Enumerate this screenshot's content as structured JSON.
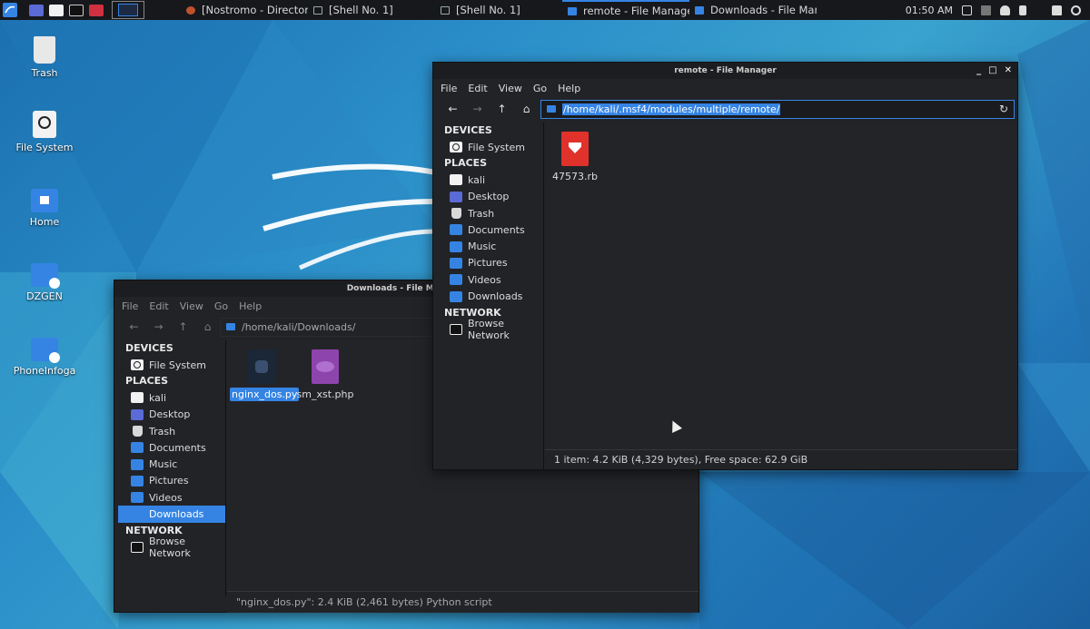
{
  "panel": {
    "tasks": [
      {
        "label": "[Nostromo - Directory T..."
      },
      {
        "label": "[Shell No. 1]"
      },
      {
        "label": "[Shell No. 1]"
      },
      {
        "label": "remote - File Manager"
      },
      {
        "label": "Downloads - File Manag..."
      }
    ],
    "clock": "01:50 AM"
  },
  "desktop": {
    "icons": [
      {
        "label": "Trash"
      },
      {
        "label": "File System"
      },
      {
        "label": "Home"
      },
      {
        "label": "DZGEN"
      },
      {
        "label": "PhoneInfoga"
      }
    ]
  },
  "menu": [
    "File",
    "Edit",
    "View",
    "Go",
    "Help"
  ],
  "sidebar": {
    "devices_header": "DEVICES",
    "places_header": "PLACES",
    "network_header": "NETWORK",
    "file_system": "File System",
    "places": [
      "kali",
      "Desktop",
      "Trash",
      "Documents",
      "Music",
      "Pictures",
      "Videos",
      "Downloads"
    ],
    "browse_network": "Browse Network"
  },
  "win_remote": {
    "title": "remote - File Manager",
    "path": "/home/kali/.msf4/modules/multiple/remote/",
    "files": [
      {
        "name": "47573.rb",
        "icon": "ruby-file-icon",
        "color": "#e0312b"
      }
    ],
    "status": "1 item: 4.2 KiB (4,329 bytes), Free space: 62.9 GiB"
  },
  "win_downloads": {
    "title": "Downloads - File Manager",
    "path": "/home/kali/Downloads/",
    "files": [
      {
        "name": "nginx_dos.py",
        "icon": "python-file-icon",
        "color": "#1b2636"
      },
      {
        "name": "sm_xst.php",
        "icon": "php-file-icon",
        "color": "#8e44ad"
      }
    ],
    "status": "\"nginx_dos.py\": 2.4 KiB (2,461 bytes) Python script",
    "selected_place": "Downloads"
  },
  "colors": {
    "accent": "#3584e4",
    "panel": "#17181c",
    "window": "#222327"
  }
}
